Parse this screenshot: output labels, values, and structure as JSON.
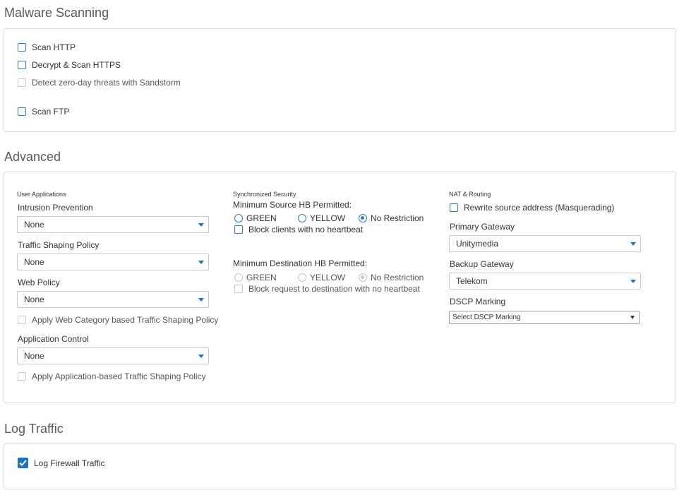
{
  "malware": {
    "title": "Malware Scanning",
    "items": [
      {
        "label": "Scan HTTP",
        "checked": false,
        "enabled": true
      },
      {
        "label": "Decrypt & Scan HTTPS",
        "checked": false,
        "enabled": true
      },
      {
        "label": "Detect zero-day threats with Sandstorm",
        "checked": false,
        "enabled": false
      },
      {
        "label": "Scan FTP",
        "checked": false,
        "enabled": true
      }
    ]
  },
  "advanced": {
    "title": "Advanced",
    "user_apps": {
      "heading": "User Applications",
      "intrusion_label": "Intrusion Prevention",
      "intrusion_value": "None",
      "shaping_label": "Traffic Shaping Policy",
      "shaping_value": "None",
      "web_label": "Web Policy",
      "web_value": "None",
      "web_category_shaping": "Apply Web Category based Traffic Shaping Policy",
      "app_control_label": "Application Control",
      "app_control_value": "None",
      "app_shaping": "Apply Application-based Traffic Shaping Policy"
    },
    "sync_security": {
      "heading": "Synchronized Security",
      "source_label": "Minimum Source HB Permitted:",
      "source_options": [
        "GREEN",
        "YELLOW",
        "No Restriction"
      ],
      "source_selected": "No Restriction",
      "block_clients": "Block clients with no heartbeat",
      "dest_label": "Minimum Destination HB Permitted:",
      "dest_options": [
        "GREEN",
        "YELLOW",
        "No Restriction"
      ],
      "dest_selected": "No Restriction",
      "block_request": "Block request to destination with no heartbeat"
    },
    "nat": {
      "heading": "NAT & Routing",
      "rewrite": "Rewrite source address (Masquerading)",
      "primary_label": "Primary Gateway",
      "primary_value": "Unitymedia",
      "backup_label": "Backup Gateway",
      "backup_value": "Telekom",
      "dscp_label": "DSCP Marking",
      "dscp_value": "Select DSCP Marking"
    }
  },
  "log": {
    "title": "Log Traffic",
    "firewall_label": "Log Firewall Traffic",
    "firewall_checked": true
  },
  "colors": {
    "accent": "#1a73c0",
    "border": "#dcdcdc",
    "disabled": "#c7c7c7"
  }
}
